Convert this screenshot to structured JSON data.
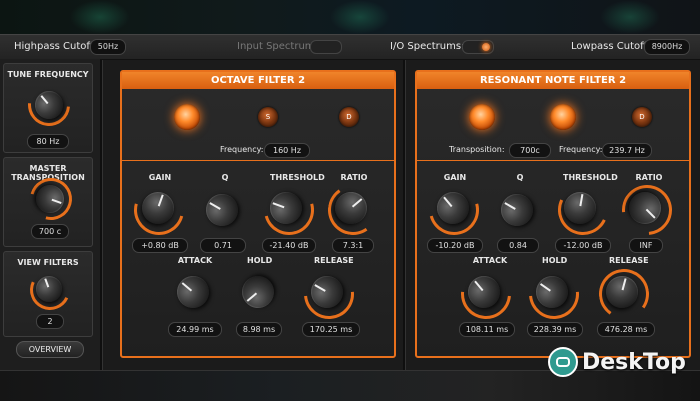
{
  "topbar": {
    "highpass_label": "Highpass Cutoff",
    "highpass_value": "50Hz",
    "input_spectrum_label": "Input Spectrum:",
    "io_spectrums_label": "I/O Spectrums:",
    "lowpass_label": "Lowpass Cutoff",
    "lowpass_value": "8900Hz"
  },
  "sidebar": {
    "tune": {
      "title": "TUNE FREQUENCY",
      "value": "80 Hz"
    },
    "transposition": {
      "title": "MASTER TRANSPOSITION",
      "value": "700 c"
    },
    "view": {
      "title": "VIEW FILTERS",
      "value": "2"
    },
    "overview_label": "OVERVIEW"
  },
  "filters": [
    {
      "title": "OCTAVE FILTER 2",
      "leds": [
        "",
        "S",
        "D"
      ],
      "frequency_label": "Frequency:",
      "frequency_value": "160 Hz",
      "knobs": {
        "gain": {
          "label": "GAIN",
          "value": "+0.80 dB"
        },
        "q": {
          "label": "Q",
          "value": "0.71"
        },
        "threshold": {
          "label": "THRESHOLD",
          "value": "-21.40 dB"
        },
        "ratio": {
          "label": "RATIO",
          "value": "7.3:1"
        },
        "attack": {
          "label": "ATTACK",
          "value": "24.99 ms"
        },
        "hold": {
          "label": "HOLD",
          "value": "8.98 ms"
        },
        "release": {
          "label": "RELEASE",
          "value": "170.25 ms"
        }
      }
    },
    {
      "title": "RESONANT NOTE FILTER 2",
      "leds": [
        "",
        "",
        "D"
      ],
      "transposition_label": "Transposition:",
      "transposition_value": "700c",
      "frequency_label": "Frequency:",
      "frequency_value": "239.7 Hz",
      "knobs": {
        "gain": {
          "label": "GAIN",
          "value": "-10.20 dB"
        },
        "q": {
          "label": "Q",
          "value": "0.84"
        },
        "threshold": {
          "label": "THRESHOLD",
          "value": "-12.00 dB"
        },
        "ratio": {
          "label": "RATIO",
          "value": "INF"
        },
        "attack": {
          "label": "ATTACK",
          "value": "108.11 ms"
        },
        "hold": {
          "label": "HOLD",
          "value": "228.39 ms"
        },
        "release": {
          "label": "RELEASE",
          "value": "476.28 ms"
        }
      }
    }
  ],
  "watermark": {
    "text": "DeskTop"
  },
  "colors": {
    "accent": "#e8701c",
    "panel": "#252525"
  }
}
